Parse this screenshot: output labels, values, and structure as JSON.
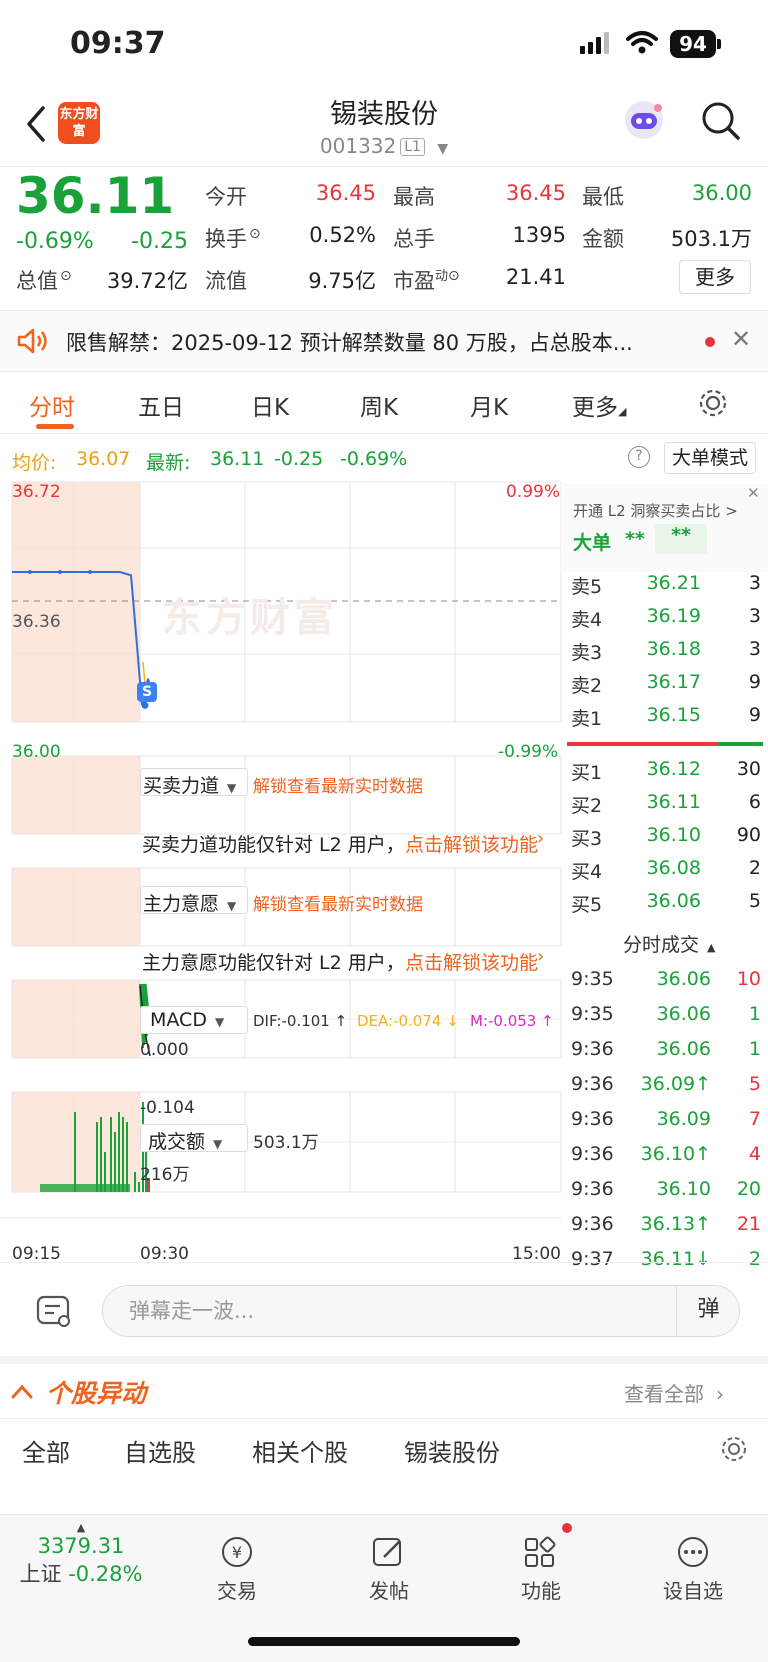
{
  "status": {
    "time": "09:37",
    "battery": "94"
  },
  "header": {
    "stock_name": "锡装股份",
    "code": "001332",
    "level": "L1",
    "logo_text": "东方财富"
  },
  "quote": {
    "price": "36.11",
    "change_pct": "-0.69%",
    "change": "-0.25",
    "fields": [
      {
        "label": "今开",
        "value": "36.45",
        "color": "#e8343b"
      },
      {
        "label": "最高",
        "value": "36.45",
        "color": "#e8343b"
      },
      {
        "label": "最低",
        "value": "36.00",
        "color": "#1aa23a"
      },
      {
        "label": "换手",
        "value": "0.52%",
        "color": "#222222"
      },
      {
        "label": "总手",
        "value": "1395",
        "color": "#222222"
      },
      {
        "label": "金额",
        "value": "503.1万",
        "color": "#222222"
      },
      {
        "label": "总值",
        "value": "39.72亿",
        "color": "#222222"
      },
      {
        "label": "流值",
        "value": "9.75亿",
        "color": "#222222"
      },
      {
        "label": "市盈",
        "label_sup": "动",
        "value": "21.41",
        "color": "#222222"
      }
    ],
    "more_label": "更多"
  },
  "notice": {
    "text": "限售解禁：2025-09-12 预计解禁数量 80 万股，占总股本..."
  },
  "tabs": [
    "分时",
    "五日",
    "日K",
    "周K",
    "月K",
    "更多"
  ],
  "info_row": {
    "avg_label": "均价:",
    "avg_value": "36.07",
    "latest_label": "最新:",
    "latest_value": "36.11",
    "latest_change": "-0.25",
    "latest_pct": "-0.69%",
    "big_order_mode": "大单模式"
  },
  "chart": {
    "watermark": "东方财富",
    "price_high": "36.72",
    "price_mid": "36.36",
    "price_low": "36.00",
    "pct_high": "0.99%",
    "pct_low": "-0.99%",
    "s_marker": "S",
    "time_start": "09:15",
    "time_open": "09:30",
    "time_end": "15:00",
    "macd_label": "MACD",
    "dif": "DIF:-0.101 ↑",
    "dea": "DEA:-0.074 ↓",
    "m": "M:-0.053 ↑",
    "macd_top": "0.000",
    "macd_bottom": "-0.104",
    "volume_label": "成交额",
    "volume_value": "503.1万",
    "volume_top": "216万",
    "power_label": "买卖力道",
    "power_unlock": "解锁查看最新实时数据",
    "power_msg": "买卖力道功能仅针对 L2 用户，",
    "power_link": "点击解锁该功能",
    "intent_label": "主力意愿",
    "intent_unlock": "解锁查看最新实时数据",
    "intent_msg": "主力意愿功能仅针对 L2 用户，",
    "intent_link": "点击解锁该功能"
  },
  "chart_data": {
    "type": "line",
    "title": "",
    "x_ticks": [
      "09:15",
      "09:30",
      "15:00"
    ],
    "ylim": [
      36.0,
      36.72
    ],
    "y_ticks": [
      "36.72",
      "36.36",
      "36.00"
    ],
    "series": [
      {
        "values": [
          36.45,
          36.45,
          36.45,
          36.45,
          36.45,
          36.44,
          36.3,
          36.05,
          36.06,
          36.09,
          36.1,
          36.13,
          36.11
        ]
      }
    ]
  },
  "orderbook": {
    "l2_promo": "开通 L2 洞察买卖占比 >",
    "big_order": "大单",
    "stars1": "**",
    "stars2": "**",
    "asks": [
      {
        "label": "卖5",
        "price": "36.21",
        "vol": "3"
      },
      {
        "label": "卖4",
        "price": "36.19",
        "vol": "3"
      },
      {
        "label": "卖3",
        "price": "36.18",
        "vol": "3"
      },
      {
        "label": "卖2",
        "price": "36.17",
        "vol": "9"
      },
      {
        "label": "卖1",
        "price": "36.15",
        "vol": "9"
      }
    ],
    "bids": [
      {
        "label": "买1",
        "price": "36.12",
        "vol": "30"
      },
      {
        "label": "买2",
        "price": "36.11",
        "vol": "6"
      },
      {
        "label": "买3",
        "price": "36.10",
        "vol": "90"
      },
      {
        "label": "买4",
        "price": "36.08",
        "vol": "2"
      },
      {
        "label": "买5",
        "price": "36.06",
        "vol": "5"
      }
    ],
    "trades_title": "分时成交",
    "trades": [
      {
        "t": "9:35",
        "p": "36.06",
        "v": "10",
        "pc": "#1aa23a",
        "vc": "#e8343b"
      },
      {
        "t": "9:35",
        "p": "36.06",
        "v": "1",
        "pc": "#1aa23a",
        "vc": "#1aa23a"
      },
      {
        "t": "9:36",
        "p": "36.06",
        "v": "1",
        "pc": "#1aa23a",
        "vc": "#1aa23a"
      },
      {
        "t": "9:36",
        "p": "36.09↑",
        "v": "5",
        "pc": "#1aa23a",
        "vc": "#e8343b"
      },
      {
        "t": "9:36",
        "p": "36.09",
        "v": "7",
        "pc": "#1aa23a",
        "vc": "#e8343b"
      },
      {
        "t": "9:36",
        "p": "36.10↑",
        "v": "4",
        "pc": "#1aa23a",
        "vc": "#e8343b"
      },
      {
        "t": "9:36",
        "p": "36.10",
        "v": "20",
        "pc": "#1aa23a",
        "vc": "#1aa23a"
      },
      {
        "t": "9:36",
        "p": "36.13↑",
        "v": "21",
        "pc": "#1aa23a",
        "vc": "#e8343b"
      },
      {
        "t": "9:37",
        "p": "36.11↓",
        "v": "2",
        "pc": "#1aa23a",
        "vc": "#1aa23a"
      }
    ]
  },
  "comment": {
    "placeholder": "弹幕走一波...",
    "danmu": "弹"
  },
  "movement": {
    "title": "个股异动",
    "view_all": "查看全部"
  },
  "subtabs": [
    "全部",
    "自选股",
    "相关个股",
    "锡装股份"
  ],
  "bottom_nav": {
    "index_value": "3379.31",
    "index_name": "上证",
    "index_change": "-0.28%",
    "items": [
      "交易",
      "发帖",
      "功能",
      "设自选"
    ]
  }
}
